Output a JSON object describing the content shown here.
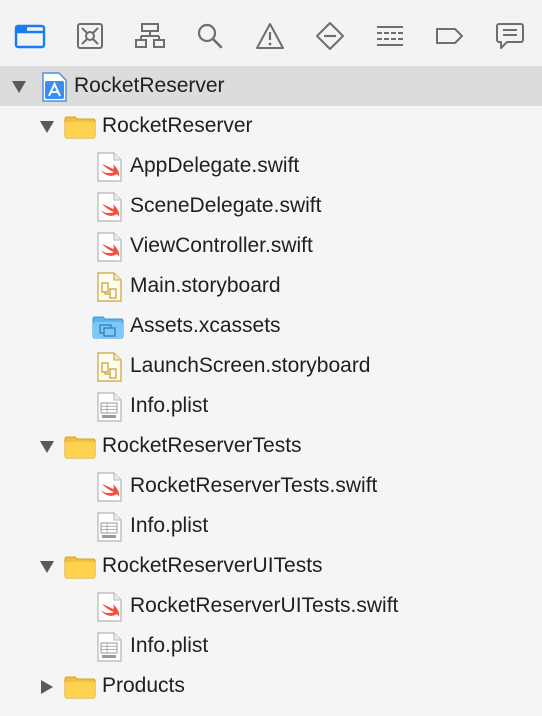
{
  "toolbar": {
    "buttons": [
      {
        "icon": "folder-navigator-icon",
        "active": true
      },
      {
        "icon": "source-control-icon",
        "active": false
      },
      {
        "icon": "symbol-hierarchy-icon",
        "active": false
      },
      {
        "icon": "search-icon",
        "active": false
      },
      {
        "icon": "warning-icon",
        "active": false
      },
      {
        "icon": "test-diamond-icon",
        "active": false
      },
      {
        "icon": "debug-list-icon",
        "active": false
      },
      {
        "icon": "breakpoint-tag-icon",
        "active": false
      },
      {
        "icon": "report-bubble-icon",
        "active": false
      }
    ],
    "accent_color": "#1a7cf3"
  },
  "tree": {
    "project": {
      "label": "RocketReserver",
      "icon": "xcode-project-icon",
      "expanded": true
    },
    "groups": [
      {
        "label": "RocketReserver",
        "icon": "folder-icon",
        "expanded": true,
        "files": [
          {
            "label": "AppDelegate.swift",
            "icon": "swift-file-icon"
          },
          {
            "label": "SceneDelegate.swift",
            "icon": "swift-file-icon"
          },
          {
            "label": "ViewController.swift",
            "icon": "swift-file-icon"
          },
          {
            "label": "Main.storyboard",
            "icon": "storyboard-file-icon"
          },
          {
            "label": "Assets.xcassets",
            "icon": "asset-catalog-icon"
          },
          {
            "label": "LaunchScreen.storyboard",
            "icon": "storyboard-file-icon"
          },
          {
            "label": "Info.plist",
            "icon": "plist-file-icon"
          }
        ]
      },
      {
        "label": "RocketReserverTests",
        "icon": "folder-icon",
        "expanded": true,
        "files": [
          {
            "label": "RocketReserverTests.swift",
            "icon": "swift-file-icon"
          },
          {
            "label": "Info.plist",
            "icon": "plist-file-icon"
          }
        ]
      },
      {
        "label": "RocketReserverUITests",
        "icon": "folder-icon",
        "expanded": true,
        "files": [
          {
            "label": "RocketReserverUITests.swift",
            "icon": "swift-file-icon"
          },
          {
            "label": "Info.plist",
            "icon": "plist-file-icon"
          }
        ]
      },
      {
        "label": "Products",
        "icon": "folder-icon",
        "expanded": false,
        "files": []
      }
    ]
  }
}
